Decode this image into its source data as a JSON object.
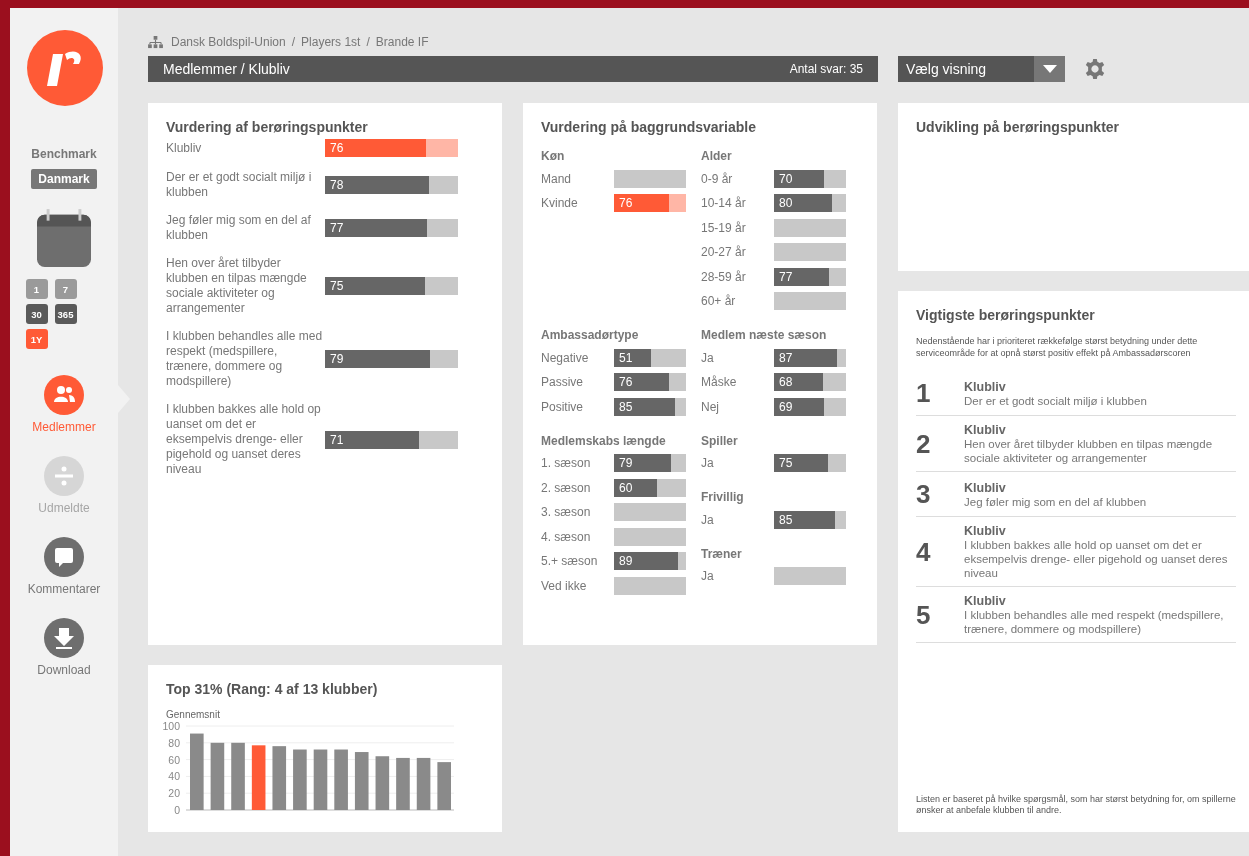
{
  "breadcrumb": {
    "separator": "/",
    "items": [
      "Dansk Boldspil-Union",
      "Players 1st",
      "Brande IF"
    ]
  },
  "header": {
    "title": "Medlemmer / Klubliv",
    "count": "Antal svar: 35"
  },
  "view_select": {
    "label": "Vælg visning"
  },
  "sidebar": {
    "benchmark_label": "Benchmark",
    "benchmark_value": "Danmark",
    "periods": [
      {
        "label": "1",
        "selected": false,
        "disabled": true
      },
      {
        "label": "7",
        "selected": false,
        "disabled": true
      },
      {
        "label": "30",
        "selected": false,
        "disabled": false
      },
      {
        "label": "365",
        "selected": false,
        "disabled": false
      },
      {
        "label": "1Y",
        "selected": true,
        "disabled": false
      }
    ],
    "nav": [
      {
        "label": "Medlemmer",
        "kind": "members",
        "selected": true,
        "disabled": false
      },
      {
        "label": "Udmeldte",
        "kind": "divide",
        "selected": false,
        "disabled": true
      },
      {
        "label": "Kommentarer",
        "kind": "comment",
        "selected": false,
        "disabled": false
      },
      {
        "label": "Download",
        "kind": "download",
        "selected": false,
        "disabled": false
      }
    ]
  },
  "touchpoints": {
    "title": "Vurdering af berøringspunkter",
    "rows": [
      {
        "label": "Klubliv",
        "value": "76",
        "level": 0.76,
        "highlight": true
      },
      {
        "label": "Der er et godt socialt miljø i klubben",
        "value": "78",
        "level": 0.78,
        "highlight": false
      },
      {
        "label": "Jeg føler mig som en del af klubben",
        "value": "77",
        "level": 0.77,
        "highlight": false
      },
      {
        "label": "Hen over året tilbyder klubben en tilpas mængde sociale aktiviteter og arrangementer",
        "value": "75",
        "level": 0.75,
        "highlight": false
      },
      {
        "label": "I klubben behandles alle med respekt (medspillere, trænere, dommere og modspillere)",
        "value": "79",
        "level": 0.79,
        "highlight": false
      },
      {
        "label": "I klubben bakkes alle hold op uanset om det er eksempelvis drenge- eller pigehold og uanset deres niveau",
        "value": "71",
        "level": 0.71,
        "highlight": false
      }
    ]
  },
  "background": {
    "title": "Vurdering på baggrundsvariable",
    "sections": [
      {
        "left": [
          {
            "title": "Køn",
            "rows": [
              {
                "label": "Mand"
              },
              {
                "label": "Kvinde",
                "value": "76",
                "level": 0.76,
                "highlight": true
              }
            ]
          }
        ],
        "right": [
          {
            "title": "Alder",
            "rows": [
              {
                "label": "0-9 år",
                "value": "70",
                "level": 0.7,
                "highlight": false
              },
              {
                "label": "10-14 år",
                "value": "80",
                "level": 0.8,
                "highlight": false
              },
              {
                "label": "15-19 år"
              },
              {
                "label": "20-27 år"
              },
              {
                "label": "28-59 år",
                "value": "77",
                "level": 0.77,
                "highlight": false
              },
              {
                "label": "60+ år"
              }
            ]
          }
        ]
      },
      {
        "left": [
          {
            "title": "Ambassadørtype",
            "rows": [
              {
                "label": "Negative",
                "value": "51",
                "level": 0.51,
                "highlight": false
              },
              {
                "label": "Passive",
                "value": "76",
                "level": 0.76,
                "highlight": false
              },
              {
                "label": "Positive",
                "value": "85",
                "level": 0.85,
                "highlight": false
              }
            ]
          }
        ],
        "right": [
          {
            "title": "Medlem næste sæson",
            "rows": [
              {
                "label": "Ja",
                "value": "87",
                "level": 0.87,
                "highlight": false
              },
              {
                "label": "Måske",
                "value": "68",
                "level": 0.68,
                "highlight": false
              },
              {
                "label": "Nej",
                "value": "69",
                "level": 0.69,
                "highlight": false
              }
            ]
          }
        ]
      },
      {
        "left": [
          {
            "title": "Medlemskabs længde",
            "rows": [
              {
                "label": "1. sæson",
                "value": "79",
                "level": 0.79,
                "highlight": false
              },
              {
                "label": "2. sæson",
                "value": "60",
                "level": 0.6,
                "highlight": false
              },
              {
                "label": "3. sæson"
              },
              {
                "label": "4. sæson"
              },
              {
                "label": "5.+ sæson",
                "value": "89",
                "level": 0.89,
                "highlight": false
              },
              {
                "label": "Ved ikke"
              }
            ]
          }
        ],
        "right": [
          {
            "title": "Spiller",
            "rows": [
              {
                "label": "Ja",
                "value": "75",
                "level": 0.75,
                "highlight": false
              }
            ]
          },
          {
            "title": "Frivillig",
            "rows": [
              {
                "label": "Ja",
                "value": "85",
                "level": 0.85,
                "highlight": false
              }
            ]
          },
          {
            "title": "Træner",
            "rows": [
              {
                "label": "Ja"
              }
            ]
          }
        ]
      }
    ]
  },
  "development": {
    "title": "Udvikling på berøringspunkter"
  },
  "ranking": {
    "title": "Top 31% (Rang: 4 af 13 klubber)",
    "chart_data": {
      "type": "bar",
      "ylabel": "Gennemsnit",
      "ylim": [
        0,
        100
      ],
      "yticks": [
        0,
        20,
        40,
        60,
        80,
        100
      ],
      "grid": true,
      "series": [
        {
          "color": "#8a8a8a",
          "values": [
            91,
            80,
            80,
            null,
            76,
            72,
            72,
            72,
            69,
            64,
            62,
            62,
            57
          ]
        },
        {
          "color": "#ff5a36",
          "values": [
            null,
            null,
            null,
            77,
            null,
            null,
            null,
            null,
            null,
            null,
            null,
            null,
            null
          ]
        }
      ]
    }
  },
  "important": {
    "title": "Vigtigste berøringspunkter",
    "intro": "Nedenstående har i prioriteret rækkefølge størst betydning under dette serviceområde for at opnå størst positiv effekt på Ambassadørscoren",
    "items": [
      {
        "rank": "1",
        "category": "Klubliv",
        "text": "Der er et godt socialt miljø i klubben"
      },
      {
        "rank": "2",
        "category": "Klubliv",
        "text": "Hen over året tilbyder klubben en tilpas mængde sociale aktiviteter og arrangementer"
      },
      {
        "rank": "3",
        "category": "Klubliv",
        "text": "Jeg føler mig som en del af klubben"
      },
      {
        "rank": "4",
        "category": "Klubliv",
        "text": "I klubben bakkes alle hold op uanset om det er eksempelvis drenge- eller pigehold og uanset deres niveau"
      },
      {
        "rank": "5",
        "category": "Klubliv",
        "text": "I klubben behandles alle med respekt (medspillere, trænere, dommere og modspillere)"
      }
    ],
    "footnote": "Listen er baseret på hvilke spørgsmål, som har størst betydning for, om spillerne ønsker at anbefale klubben til andre."
  }
}
